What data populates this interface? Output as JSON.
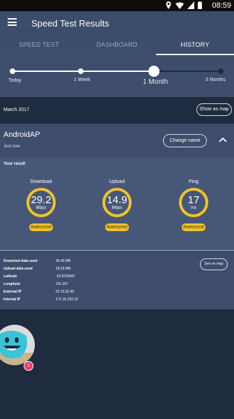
{
  "status_bar": {
    "time": "08:59",
    "icons": [
      "location-icon",
      "wifi-icon",
      "signal-icon",
      "battery-icon"
    ]
  },
  "app_bar": {
    "title": "Speed Test Results",
    "menu_icon": "hamburger-menu-icon"
  },
  "tabs": [
    {
      "label": "SPEED TEST",
      "active": false
    },
    {
      "label": "DASHBOARD",
      "active": false
    },
    {
      "label": "HISTORY",
      "active": true
    }
  ],
  "timeline": {
    "stops": [
      "Today",
      "1 Week",
      "1 Month",
      "3 Months"
    ],
    "selected": "1 Month"
  },
  "month_bar": {
    "month": "March 2017",
    "map_button": "Show as map"
  },
  "network": {
    "name": "AndroidAP",
    "when": "Just now",
    "change_button": "Change name",
    "collapse_icon": "chevron-up-icon"
  },
  "result": {
    "heading": "Your result",
    "metrics": [
      {
        "label": "Download",
        "value": "29.2",
        "unit": "Mbps",
        "rating": "Awesome"
      },
      {
        "label": "Upload",
        "value": "14.9",
        "unit": "Mbps",
        "rating": "Awesome"
      },
      {
        "label": "Ping",
        "value": "17",
        "unit": "ms",
        "rating": "Awesome"
      }
    ]
  },
  "details": {
    "rows": [
      {
        "key": "Download data used",
        "value": "36.49 MB"
      },
      {
        "key": "Upload data used",
        "value": "18.59 MB"
      },
      {
        "key": "Latitude",
        "value": "-33.8703567"
      },
      {
        "key": "Longitude",
        "value": "151.207"
      },
      {
        "key": "External IP",
        "value": "62.15.32.40"
      },
      {
        "key": "Internal IP",
        "value": "172.16.152.15"
      }
    ],
    "map_button": "See on map"
  },
  "chat": {
    "avatar": "smiley-character-avatar",
    "badge": "1"
  },
  "colors": {
    "app_bar": "#3c4c6b",
    "background": "#1f2b3e",
    "accent": "#f3c227",
    "panel": "#475777"
  }
}
